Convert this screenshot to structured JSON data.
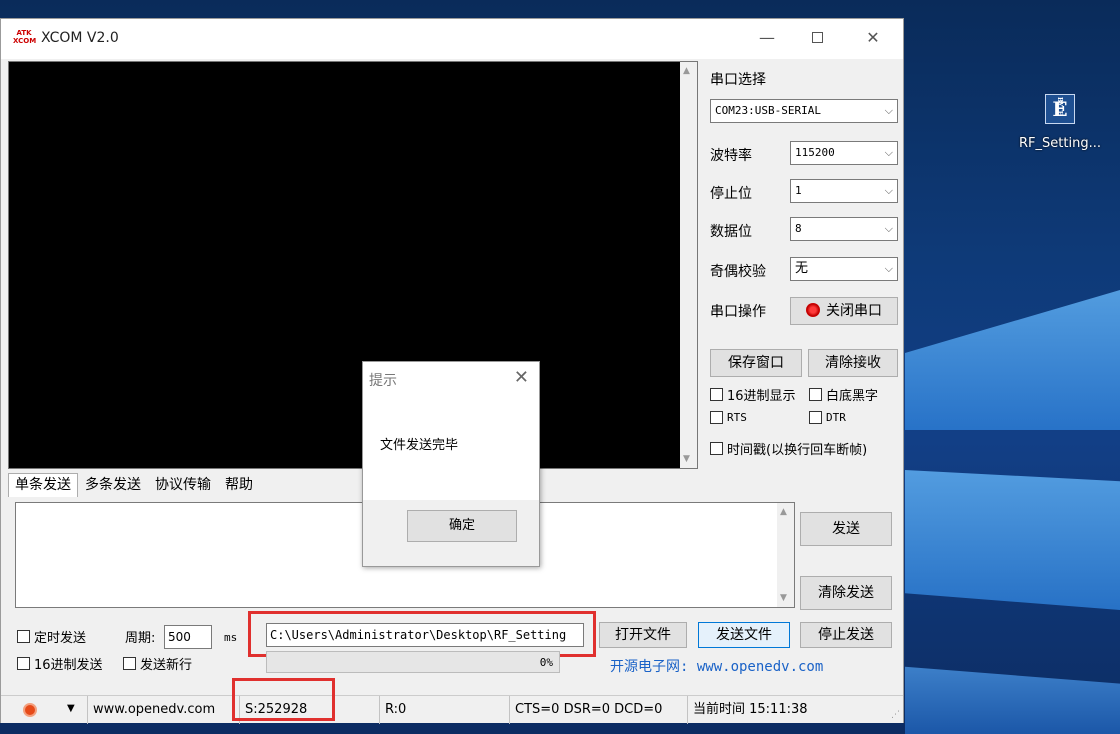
{
  "window": {
    "title": "XCOM V2.0"
  },
  "serial": {
    "port_label": "串口选择",
    "port_value": "COM23:USB-SERIAL",
    "baud_label": "波特率",
    "baud_value": "115200",
    "stop_label": "停止位",
    "stop_value": "1",
    "data_label": "数据位",
    "data_value": "8",
    "parity_label": "奇偶校验",
    "parity_value": "无",
    "op_label": "串口操作",
    "op_button": "关闭串口",
    "save_window": "保存窗口",
    "clear_recv": "清除接收",
    "hex_display": "16进制显示",
    "white_bg": "白底黑字",
    "rts": "RTS",
    "dtr": "DTR",
    "timestamp": "时间戳(以换行回车断帧)"
  },
  "tabs": [
    "单条发送",
    "多条发送",
    "协议传输",
    "帮助"
  ],
  "send": {
    "send_button": "发送",
    "clear_send": "清除发送",
    "timed_send": "定时发送",
    "period_label": "周期:",
    "period_value": "500",
    "ms": "ms",
    "file_path": "C:\\Users\\Administrator\\Desktop\\RF_Setting",
    "open_file": "打开文件",
    "send_file": "发送文件",
    "stop_send": "停止发送",
    "hex_send": "16进制发送",
    "newline": "发送新行",
    "progress_percent": "0%",
    "progress_value": 0,
    "brand": "开源电子网: www.openedv.com"
  },
  "status": {
    "url": "www.openedv.com",
    "sent": "S:252928",
    "received": "R:0",
    "lines": "CTS=0 DSR=0 DCD=0",
    "time": "当前时间 15:11:38"
  },
  "dialog": {
    "title": "提示",
    "message": "文件发送完毕",
    "ok": "确定"
  },
  "desktop": {
    "icon_label": "RF_Setting..."
  },
  "colors": {
    "highlight": "#e0302e",
    "brand": "#1a62c7",
    "recv_bg": "#000000"
  }
}
